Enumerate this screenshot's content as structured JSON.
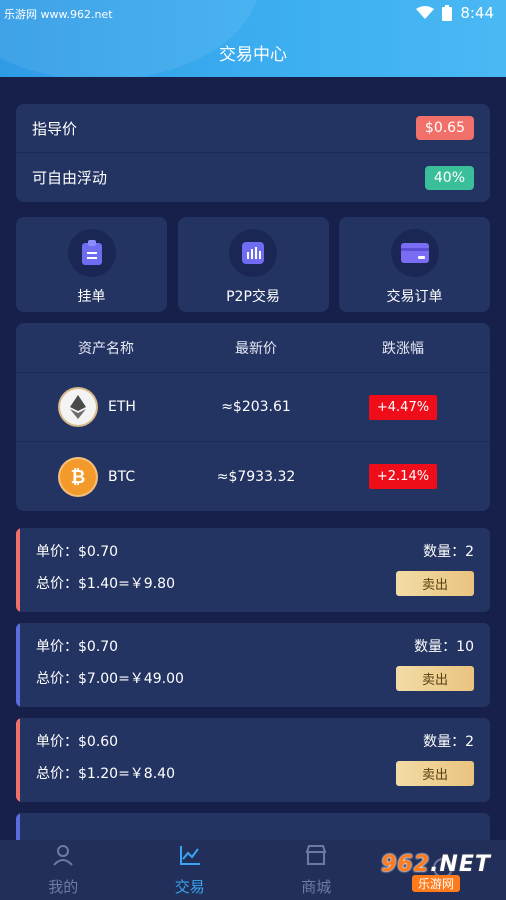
{
  "status_bar": {
    "watermark": "乐游网 www.962.net",
    "time": "8:44"
  },
  "header": {
    "title": "交易中心"
  },
  "guide": {
    "price_label": "指导价",
    "price_value": "$0.65",
    "float_label": "可自由浮动",
    "float_value": "40%"
  },
  "actions": [
    {
      "label": "挂单",
      "icon": "clipboard-icon"
    },
    {
      "label": "P2P交易",
      "icon": "bar-chart-icon"
    },
    {
      "label": "交易订单",
      "icon": "card-icon"
    }
  ],
  "assets": {
    "headers": [
      "资产名称",
      "最新价",
      "跌涨幅"
    ],
    "rows": [
      {
        "name": "ETH",
        "price": "≈$203.61",
        "change": "+4.47%"
      },
      {
        "name": "BTC",
        "price": "≈$7933.32",
        "change": "+2.14%"
      }
    ]
  },
  "orders": [
    {
      "unit": "单价：$0.70",
      "total": "总价：$1.40=￥9.80",
      "qty": "数量：2",
      "sell": "卖出"
    },
    {
      "unit": "单价：$0.70",
      "total": "总价：$7.00=￥49.00",
      "qty": "数量：10",
      "sell": "卖出"
    },
    {
      "unit": "单价：$0.60",
      "total": "总价：$1.20=￥8.40",
      "qty": "数量：2",
      "sell": "卖出"
    }
  ],
  "nav": [
    {
      "label": "我的",
      "icon": "user-icon"
    },
    {
      "label": "交易",
      "icon": "chart-icon"
    },
    {
      "label": "商城",
      "icon": "shop-icon"
    }
  ],
  "watermark_badge": {
    "num": "962",
    "suffix": ".NET",
    "text": "乐游网"
  },
  "colors": {
    "background": "#16204a",
    "card": "#243462",
    "accent_blue": "#3aa5f0",
    "badge_red": "#f2706a",
    "badge_green": "#3bbf9a",
    "change_red": "#f00d1a",
    "order_bar_red": "#f2706a",
    "order_bar_blue": "#5b6be0"
  }
}
